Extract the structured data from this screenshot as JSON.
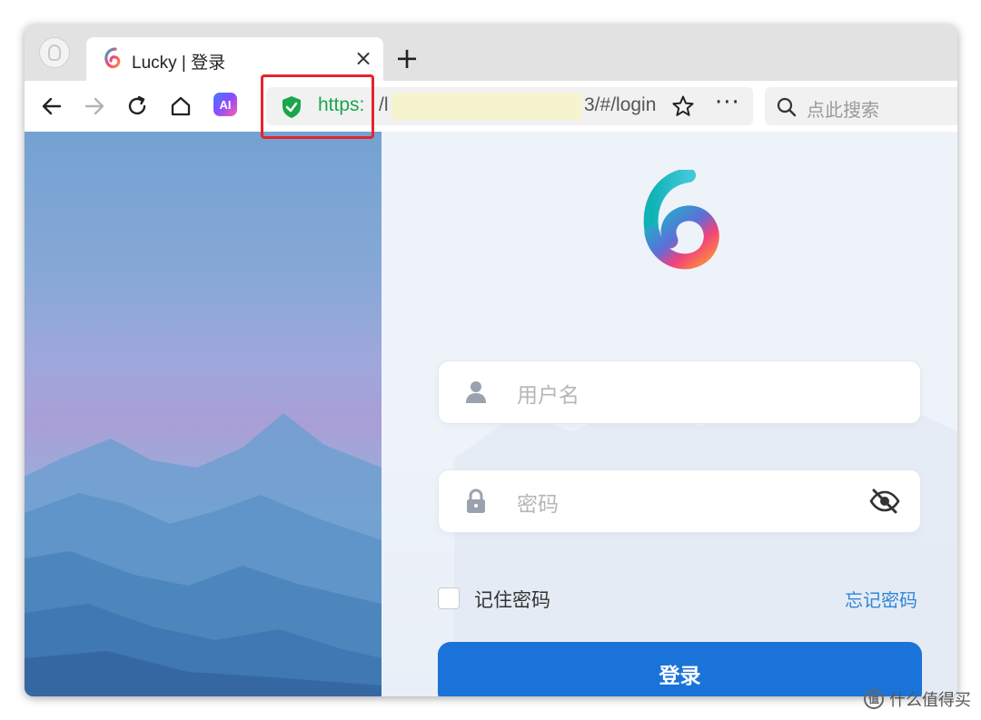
{
  "browser": {
    "tab": {
      "title": "Lucky | 登录",
      "close_glyph": "×"
    },
    "new_tab_glyph": "+",
    "address": {
      "scheme": "https:",
      "host_visible": "/l",
      "path_visible": "3/#/login"
    },
    "more_glyph": "···",
    "ai_badge": "AI",
    "search_placeholder": "点此搜索"
  },
  "login": {
    "username_placeholder": "用户名",
    "password_placeholder": "密码",
    "remember_label": "记住密码",
    "forgot_label": "忘记密码",
    "submit_label": "登录"
  },
  "colors": {
    "secure_green": "#1aa64b",
    "highlight_red": "#e8232b",
    "primary_blue": "#1a73d9",
    "link_blue": "#2f86d8"
  },
  "icons": [
    "back-icon",
    "forward-icon",
    "reload-icon",
    "home-icon",
    "shield-check-icon",
    "star-icon",
    "search-icon",
    "user-icon",
    "lock-icon",
    "eye-off-icon"
  ],
  "watermark": {
    "text": "什么值得买"
  }
}
